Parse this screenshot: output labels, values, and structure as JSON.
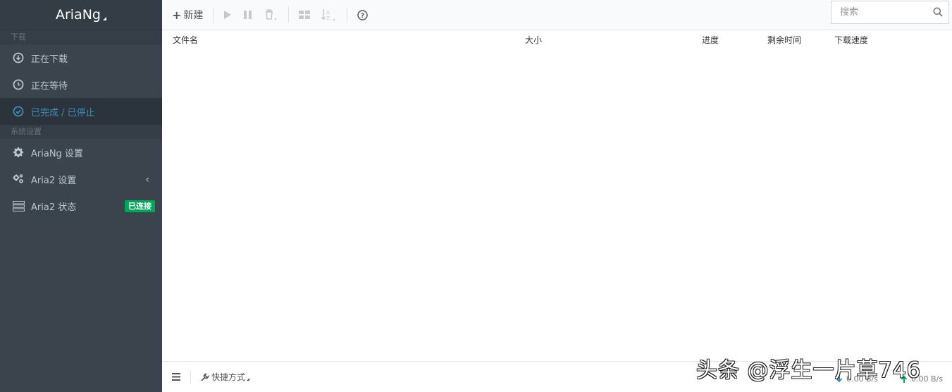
{
  "app": {
    "brand": "AriaNg"
  },
  "sidebar": {
    "sections": [
      {
        "header": "下载",
        "items": [
          {
            "label": "正在下载",
            "icon": "download-circle-icon"
          },
          {
            "label": "正在等待",
            "icon": "clock-icon"
          },
          {
            "label": "已完成 / 已停止",
            "icon": "check-circle-icon",
            "active": true
          }
        ]
      },
      {
        "header": "系统设置",
        "items": [
          {
            "label": "AriaNg 设置",
            "icon": "gear-icon"
          },
          {
            "label": "Aria2 设置",
            "icon": "gears-icon",
            "chevron": "‹"
          },
          {
            "label": "Aria2 状态",
            "icon": "server-icon",
            "badge": "已连接"
          }
        ]
      }
    ]
  },
  "toolbar": {
    "new_label": "新建",
    "search_placeholder": "搜索"
  },
  "table": {
    "columns": [
      "文件名",
      "大小",
      "进度",
      "剩余时间",
      "下载速度"
    ]
  },
  "footer": {
    "shortcut_label": "快捷方式",
    "download_speed": "0.00 B/s",
    "upload_speed": "0.00 B/s"
  },
  "watermark": "头条 @浮生一片草746",
  "colors": {
    "sidebar_bg": "#3b444d",
    "active": "#3c8dbc",
    "badge_bg": "#00a65a"
  }
}
